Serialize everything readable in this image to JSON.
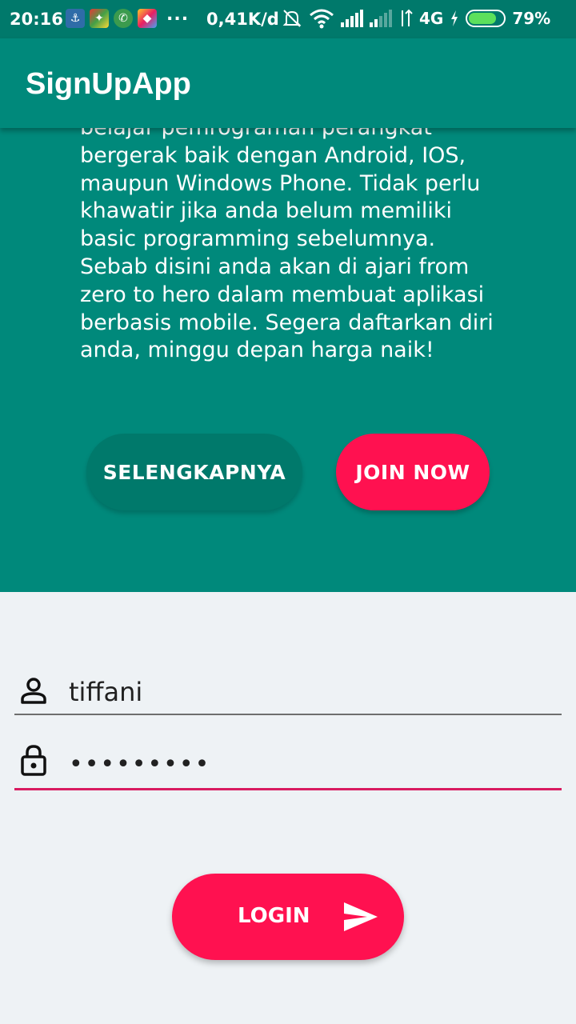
{
  "status_bar": {
    "time": "20:16",
    "more": "...",
    "net_speed": "0,41K/d",
    "network_type": "4G",
    "battery_percent": "79%",
    "battery_level": 0.79
  },
  "app_bar": {
    "title": "SignUpApp"
  },
  "hero": {
    "description": "belajar pemrograman perangkat bergerak baik dengan Android, IOS, maupun Windows Phone. Tidak perlu khawatir jika anda belum memiliki basic programming sebelumnya. Sebab disini anda akan di ajari from zero to hero dalam membuat aplikasi berbasis mobile. Segera daftarkan diri anda, minggu depan harga naik!",
    "more_button": "SELENGKAPNYA",
    "join_button": "JOIN NOW"
  },
  "login_form": {
    "username_value": "tiffani",
    "password_value": "•••••••••",
    "login_button": "LOGIN"
  },
  "colors": {
    "primary": "#00897b",
    "primary_dark": "#00796b",
    "accent": "#ff1150",
    "focus_underline": "#d81b60",
    "background": "#eef2f5"
  },
  "icons": {
    "username": "person-icon",
    "password": "lock-icon",
    "login": "send-icon"
  }
}
